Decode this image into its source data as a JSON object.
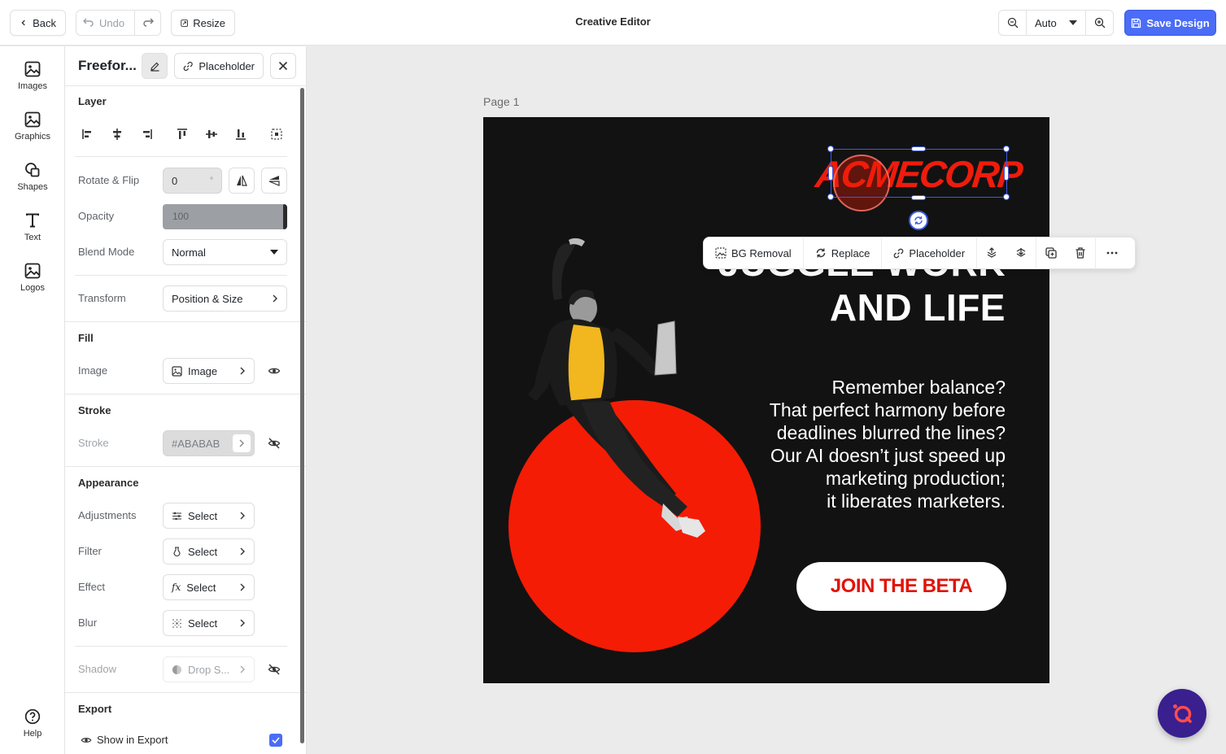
{
  "topbar": {
    "back_label": "Back",
    "undo_label": "Undo",
    "resize_label": "Resize",
    "title": "Creative Editor",
    "zoom_value": "Auto",
    "save_label": "Save Design"
  },
  "rail": {
    "items": [
      {
        "label": "Images",
        "icon": "image-icon"
      },
      {
        "label": "Graphics",
        "icon": "image-icon"
      },
      {
        "label": "Shapes",
        "icon": "shapes-icon"
      },
      {
        "label": "Text",
        "icon": "text-icon"
      },
      {
        "label": "Logos",
        "icon": "image-icon"
      }
    ],
    "help_label": "Help"
  },
  "panel": {
    "element_title": "Freefor...",
    "placeholder_label": "Placeholder",
    "layer": {
      "heading": "Layer",
      "rotate_label": "Rotate & Flip",
      "rotate_value": "0",
      "rotate_unit": "°",
      "opacity_label": "Opacity",
      "opacity_value": "100",
      "opacity_fill": 1.0,
      "blend_label": "Blend Mode",
      "blend_value": "Normal",
      "transform_label": "Transform",
      "transform_value": "Position & Size"
    },
    "fill": {
      "heading": "Fill",
      "image_label": "Image",
      "image_value": "Image"
    },
    "stroke": {
      "heading": "Stroke",
      "stroke_label": "Stroke",
      "stroke_value": "#ABABAB"
    },
    "appearance": {
      "heading": "Appearance",
      "rows": [
        {
          "label": "Adjustments",
          "value": "Select",
          "icon": "sliders-icon"
        },
        {
          "label": "Filter",
          "value": "Select",
          "icon": "filter-icon"
        },
        {
          "label": "Effect",
          "value": "Select",
          "icon": "fx-icon"
        },
        {
          "label": "Blur",
          "value": "Select",
          "icon": "blur-icon"
        }
      ],
      "shadow_label": "Shadow",
      "shadow_value": "Drop S..."
    },
    "export": {
      "heading": "Export",
      "show_label": "Show in Export",
      "show_checked": true
    }
  },
  "canvas": {
    "page_label": "Page 1",
    "logo_text": "ACMECORP",
    "headline_top": "JUGGLE WORK",
    "headline_bottom": "AND LIFE",
    "body_lines": [
      "Remember balance?",
      "That perfect harmony before",
      "deadlines blurred the lines?",
      "Our AI doesn’t just speed up",
      "marketing production;",
      "it liberates marketers."
    ],
    "cta_label": "JOIN THE BETA",
    "accent_color": "#f41c05",
    "background_color": "#121212"
  },
  "context_toolbar": {
    "bg_removal_label": "BG Removal",
    "replace_label": "Replace",
    "placeholder_label": "Placeholder"
  }
}
